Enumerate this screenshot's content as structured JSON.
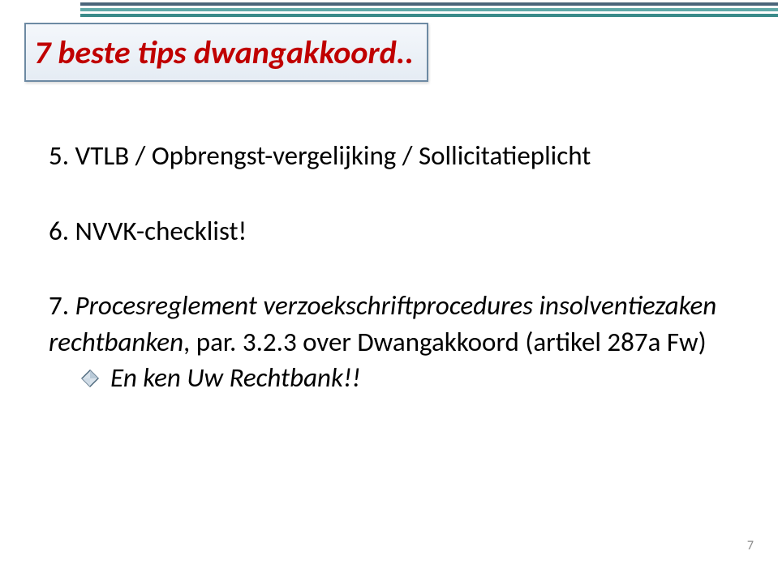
{
  "slide": {
    "title": "7 beste tips dwangakkoord..",
    "items": [
      {
        "num": "5.",
        "text": "VTLB / Opbrengst-vergelijking / Sollicitatieplicht"
      },
      {
        "num": "6.",
        "text": "NVVK-checklist!"
      },
      {
        "num": "7.",
        "text_italic": "Procesreglement verzoekschriftprocedures insolventiezaken rechtbanken",
        "text_after": ", par. 3.2.3 over Dwangakkoord (artikel 287a Fw)"
      }
    ],
    "sub_bullet": "En ken Uw Rechtbank!!",
    "page_number": "7"
  }
}
